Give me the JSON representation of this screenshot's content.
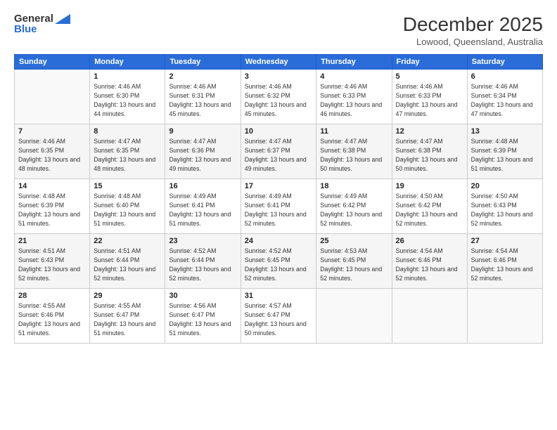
{
  "logo": {
    "line1": "General",
    "line2": "Blue"
  },
  "title": "December 2025",
  "location": "Lowood, Queensland, Australia",
  "days_of_week": [
    "Sunday",
    "Monday",
    "Tuesday",
    "Wednesday",
    "Thursday",
    "Friday",
    "Saturday"
  ],
  "weeks": [
    [
      {
        "day": "",
        "sunrise": "",
        "sunset": "",
        "daylight": ""
      },
      {
        "day": "1",
        "sunrise": "Sunrise: 4:46 AM",
        "sunset": "Sunset: 6:30 PM",
        "daylight": "Daylight: 13 hours and 44 minutes."
      },
      {
        "day": "2",
        "sunrise": "Sunrise: 4:46 AM",
        "sunset": "Sunset: 6:31 PM",
        "daylight": "Daylight: 13 hours and 45 minutes."
      },
      {
        "day": "3",
        "sunrise": "Sunrise: 4:46 AM",
        "sunset": "Sunset: 6:32 PM",
        "daylight": "Daylight: 13 hours and 45 minutes."
      },
      {
        "day": "4",
        "sunrise": "Sunrise: 4:46 AM",
        "sunset": "Sunset: 6:33 PM",
        "daylight": "Daylight: 13 hours and 46 minutes."
      },
      {
        "day": "5",
        "sunrise": "Sunrise: 4:46 AM",
        "sunset": "Sunset: 6:33 PM",
        "daylight": "Daylight: 13 hours and 47 minutes."
      },
      {
        "day": "6",
        "sunrise": "Sunrise: 4:46 AM",
        "sunset": "Sunset: 6:34 PM",
        "daylight": "Daylight: 13 hours and 47 minutes."
      }
    ],
    [
      {
        "day": "7",
        "sunrise": "Sunrise: 4:46 AM",
        "sunset": "Sunset: 6:35 PM",
        "daylight": "Daylight: 13 hours and 48 minutes."
      },
      {
        "day": "8",
        "sunrise": "Sunrise: 4:47 AM",
        "sunset": "Sunset: 6:35 PM",
        "daylight": "Daylight: 13 hours and 48 minutes."
      },
      {
        "day": "9",
        "sunrise": "Sunrise: 4:47 AM",
        "sunset": "Sunset: 6:36 PM",
        "daylight": "Daylight: 13 hours and 49 minutes."
      },
      {
        "day": "10",
        "sunrise": "Sunrise: 4:47 AM",
        "sunset": "Sunset: 6:37 PM",
        "daylight": "Daylight: 13 hours and 49 minutes."
      },
      {
        "day": "11",
        "sunrise": "Sunrise: 4:47 AM",
        "sunset": "Sunset: 6:38 PM",
        "daylight": "Daylight: 13 hours and 50 minutes."
      },
      {
        "day": "12",
        "sunrise": "Sunrise: 4:47 AM",
        "sunset": "Sunset: 6:38 PM",
        "daylight": "Daylight: 13 hours and 50 minutes."
      },
      {
        "day": "13",
        "sunrise": "Sunrise: 4:48 AM",
        "sunset": "Sunset: 6:39 PM",
        "daylight": "Daylight: 13 hours and 51 minutes."
      }
    ],
    [
      {
        "day": "14",
        "sunrise": "Sunrise: 4:48 AM",
        "sunset": "Sunset: 6:39 PM",
        "daylight": "Daylight: 13 hours and 51 minutes."
      },
      {
        "day": "15",
        "sunrise": "Sunrise: 4:48 AM",
        "sunset": "Sunset: 6:40 PM",
        "daylight": "Daylight: 13 hours and 51 minutes."
      },
      {
        "day": "16",
        "sunrise": "Sunrise: 4:49 AM",
        "sunset": "Sunset: 6:41 PM",
        "daylight": "Daylight: 13 hours and 51 minutes."
      },
      {
        "day": "17",
        "sunrise": "Sunrise: 4:49 AM",
        "sunset": "Sunset: 6:41 PM",
        "daylight": "Daylight: 13 hours and 52 minutes."
      },
      {
        "day": "18",
        "sunrise": "Sunrise: 4:49 AM",
        "sunset": "Sunset: 6:42 PM",
        "daylight": "Daylight: 13 hours and 52 minutes."
      },
      {
        "day": "19",
        "sunrise": "Sunrise: 4:50 AM",
        "sunset": "Sunset: 6:42 PM",
        "daylight": "Daylight: 13 hours and 52 minutes."
      },
      {
        "day": "20",
        "sunrise": "Sunrise: 4:50 AM",
        "sunset": "Sunset: 6:43 PM",
        "daylight": "Daylight: 13 hours and 52 minutes."
      }
    ],
    [
      {
        "day": "21",
        "sunrise": "Sunrise: 4:51 AM",
        "sunset": "Sunset: 6:43 PM",
        "daylight": "Daylight: 13 hours and 52 minutes."
      },
      {
        "day": "22",
        "sunrise": "Sunrise: 4:51 AM",
        "sunset": "Sunset: 6:44 PM",
        "daylight": "Daylight: 13 hours and 52 minutes."
      },
      {
        "day": "23",
        "sunrise": "Sunrise: 4:52 AM",
        "sunset": "Sunset: 6:44 PM",
        "daylight": "Daylight: 13 hours and 52 minutes."
      },
      {
        "day": "24",
        "sunrise": "Sunrise: 4:52 AM",
        "sunset": "Sunset: 6:45 PM",
        "daylight": "Daylight: 13 hours and 52 minutes."
      },
      {
        "day": "25",
        "sunrise": "Sunrise: 4:53 AM",
        "sunset": "Sunset: 6:45 PM",
        "daylight": "Daylight: 13 hours and 52 minutes."
      },
      {
        "day": "26",
        "sunrise": "Sunrise: 4:54 AM",
        "sunset": "Sunset: 6:46 PM",
        "daylight": "Daylight: 13 hours and 52 minutes."
      },
      {
        "day": "27",
        "sunrise": "Sunrise: 4:54 AM",
        "sunset": "Sunset: 6:46 PM",
        "daylight": "Daylight: 13 hours and 52 minutes."
      }
    ],
    [
      {
        "day": "28",
        "sunrise": "Sunrise: 4:55 AM",
        "sunset": "Sunset: 6:46 PM",
        "daylight": "Daylight: 13 hours and 51 minutes."
      },
      {
        "day": "29",
        "sunrise": "Sunrise: 4:55 AM",
        "sunset": "Sunset: 6:47 PM",
        "daylight": "Daylight: 13 hours and 51 minutes."
      },
      {
        "day": "30",
        "sunrise": "Sunrise: 4:56 AM",
        "sunset": "Sunset: 6:47 PM",
        "daylight": "Daylight: 13 hours and 51 minutes."
      },
      {
        "day": "31",
        "sunrise": "Sunrise: 4:57 AM",
        "sunset": "Sunset: 6:47 PM",
        "daylight": "Daylight: 13 hours and 50 minutes."
      },
      {
        "day": "",
        "sunrise": "",
        "sunset": "",
        "daylight": ""
      },
      {
        "day": "",
        "sunrise": "",
        "sunset": "",
        "daylight": ""
      },
      {
        "day": "",
        "sunrise": "",
        "sunset": "",
        "daylight": ""
      }
    ]
  ]
}
